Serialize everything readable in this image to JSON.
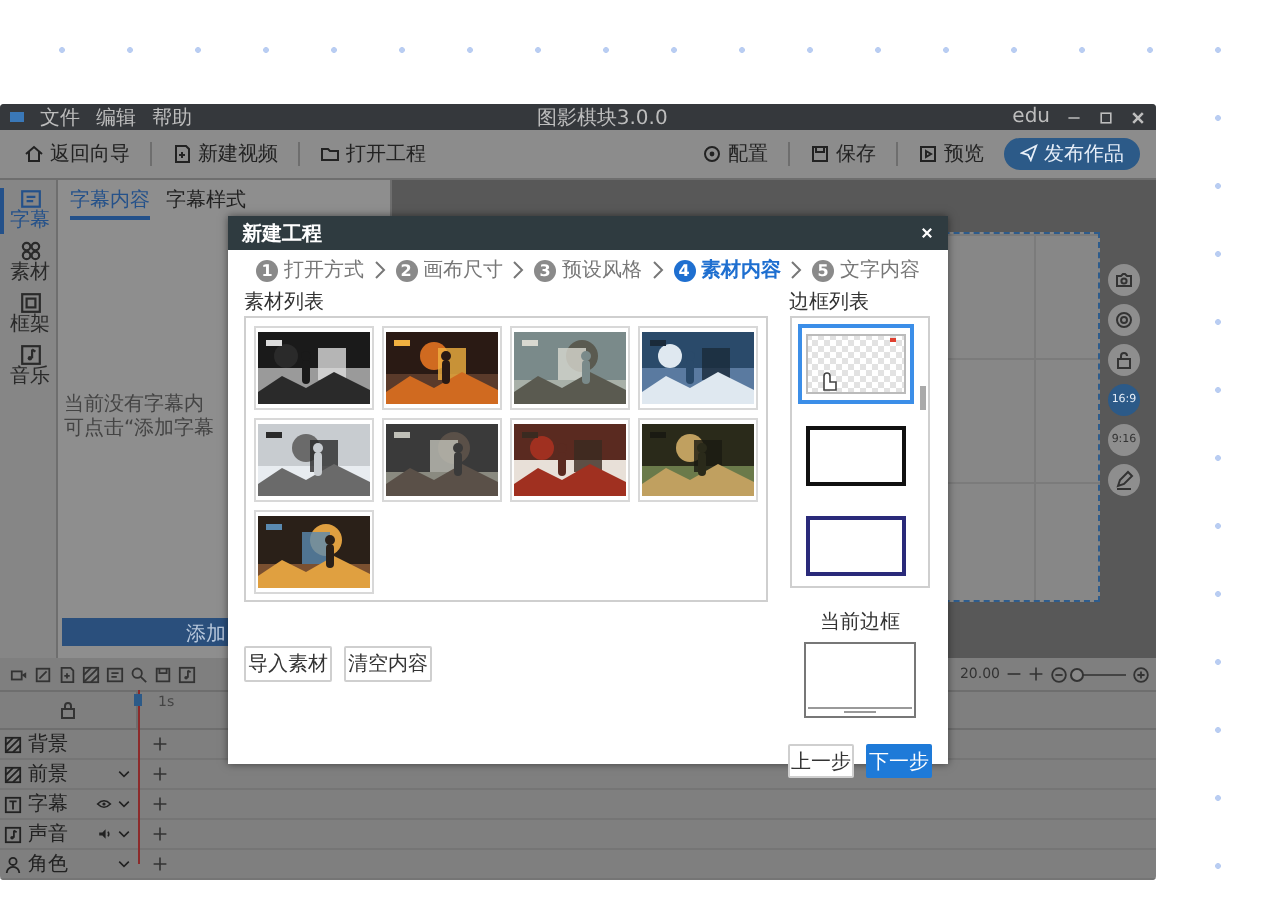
{
  "window": {
    "title": "图影棋块3.0.0",
    "account": "edu",
    "menu": [
      "文件",
      "编辑",
      "帮助"
    ]
  },
  "toolbar": {
    "left": [
      {
        "label": "返回向导",
        "kind": "home"
      },
      {
        "label": "新建视频",
        "kind": "new"
      },
      {
        "label": "打开工程",
        "kind": "folder"
      }
    ],
    "right": [
      {
        "label": "配置",
        "kind": "gear"
      },
      {
        "label": "保存",
        "kind": "save"
      },
      {
        "label": "预览",
        "kind": "preview"
      }
    ],
    "publish": "发布作品"
  },
  "sidebar": {
    "items": [
      {
        "label": "字幕",
        "kind": "subtitle",
        "selected": true
      },
      {
        "label": "素材",
        "kind": "material",
        "selected": false
      },
      {
        "label": "框架",
        "kind": "frame",
        "selected": false
      },
      {
        "label": "音乐",
        "kind": "music",
        "selected": false
      }
    ]
  },
  "panel": {
    "tabs": [
      {
        "label": "字幕内容",
        "selected": true
      },
      {
        "label": "字幕样式",
        "selected": false
      }
    ],
    "empty_lines": [
      "当前没有字幕内",
      "可点击“添加字幕"
    ],
    "add_button": "添加"
  },
  "canvas_tools": {
    "ratios": [
      {
        "label": "16:9",
        "selected": true
      },
      {
        "label": "9:16",
        "selected": false
      }
    ]
  },
  "timeline": {
    "time": "20.00",
    "zoom": {
      "level": 0.05
    },
    "tick": "1s",
    "tracks": [
      {
        "label": "背景",
        "kind": "background"
      },
      {
        "label": "前景",
        "kind": "foreground"
      },
      {
        "label": "字幕",
        "kind": "subtitle"
      },
      {
        "label": "声音",
        "kind": "sound"
      },
      {
        "label": "角色",
        "kind": "character"
      }
    ]
  },
  "dialog": {
    "title": "新建工程",
    "steps": [
      {
        "number": "1",
        "label": "打开方式",
        "selected": false
      },
      {
        "number": "2",
        "label": "画布尺寸",
        "selected": false
      },
      {
        "number": "3",
        "label": "预设风格",
        "selected": false
      },
      {
        "number": "4",
        "label": "素材内容",
        "selected": true
      },
      {
        "number": "5",
        "label": "文字内容",
        "selected": false
      }
    ],
    "materials": {
      "title": "素材列表"
    },
    "borders": {
      "title": "边框列表",
      "items": [
        {
          "kind": "checker",
          "selected": true
        },
        {
          "kind": "frame",
          "color": "#111111",
          "selected": false
        },
        {
          "kind": "frame",
          "color": "#2a2a7a",
          "selected": false
        }
      ]
    },
    "current_border": "当前边框",
    "import_button": "导入素材",
    "clear_button": "清空内容",
    "prev_button": "上一步",
    "next_button": "下一步"
  }
}
